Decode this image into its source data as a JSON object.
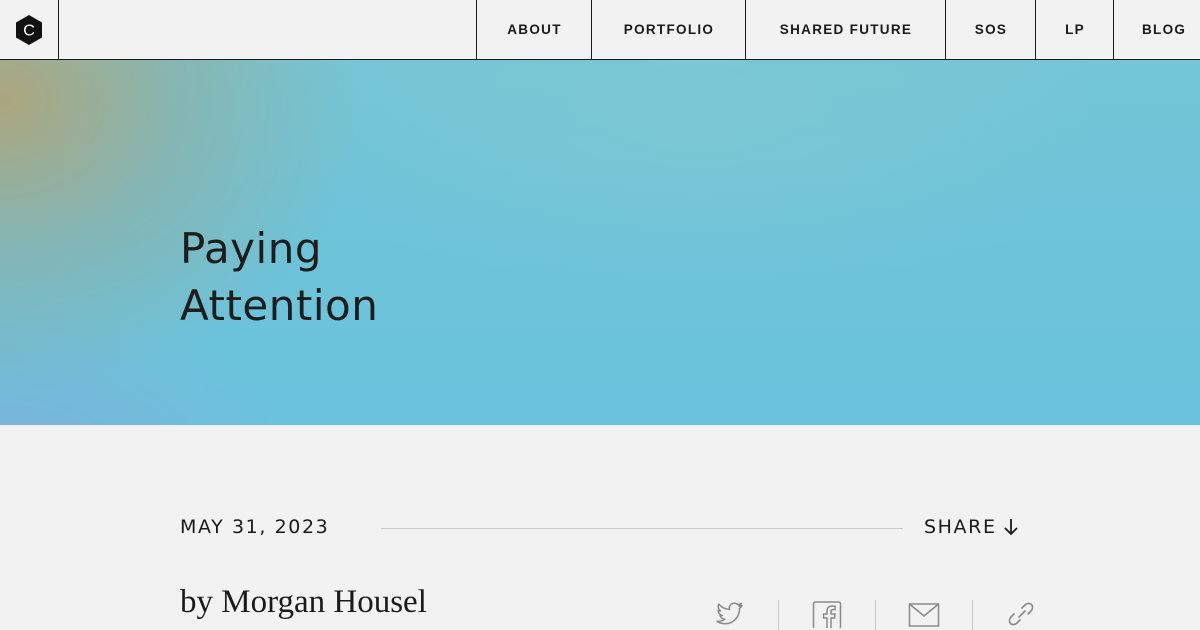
{
  "header": {
    "logo_icon": "hexagon-c-logo-icon",
    "logo_letter": "C",
    "nav": [
      {
        "label": "ABOUT"
      },
      {
        "label": "PORTFOLIO"
      },
      {
        "label": "SHARED FUTURE"
      },
      {
        "label": "SOS"
      },
      {
        "label": "LP"
      },
      {
        "label": "BLOG"
      }
    ]
  },
  "hero": {
    "title_line1": "Paying",
    "title_line2": "Attention",
    "gradient_colors": [
      "#b0a478",
      "#74c6d6",
      "#6ac2dc",
      "#82afd7"
    ]
  },
  "article": {
    "date": "MAY 31, 2023",
    "share_label": "SHARE",
    "share_icon": "arrow-down-icon",
    "byline": "by Morgan Housel",
    "share_options": [
      {
        "icon": "twitter-icon"
      },
      {
        "icon": "facebook-icon"
      },
      {
        "icon": "email-icon"
      },
      {
        "icon": "link-icon"
      }
    ]
  },
  "colors": {
    "background": "#f2f2f2",
    "text": "#1a1a1a",
    "divider": "#c9c9c9",
    "icon_gray": "#8a8a8a"
  }
}
